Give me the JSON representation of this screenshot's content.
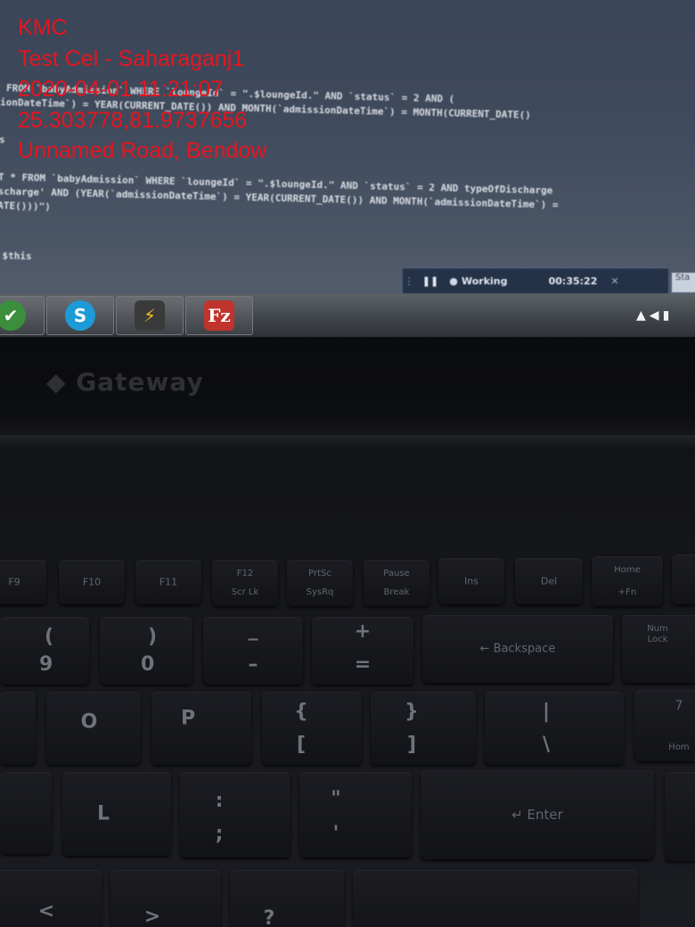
{
  "overlay": {
    "line1": "KMC",
    "line2": "Test Cel - Saharaganj1",
    "line3": "2020-04-01 11:21:07",
    "line4": "25.303778,81.9737656",
    "line5": "Unnamed Road, Bendow",
    "color": "#e8141f"
  },
  "screen": {
    "code_lines": [
      "* FROM `babyAdmission` WHERE `loungeId` = \".$loungeId.\" AND `status` = 2 AND (",
      "sionDateTime`) = YEAR(CURRENT_DATE()) AND MONTH(`admissionDateTime`) = MONTH(CURRENT_DATE()",
      "ls",
      "CT * FROM `babyAdmission` WHERE `loungeId` = \".$loungeId.\" AND `status` = 2 AND typeOfDischarge",
      "ischarge' AND (YEAR(`admissionDateTime`) = YEAR(CURRENT_DATE()) AND MONTH(`admissionDateTime`) =",
      "DATE()))\")",
      ";",
      "= $this"
    ],
    "recorder": {
      "status": "Working",
      "timer": "00:35:22"
    },
    "taskbar_apps": [
      "check-icon",
      "skype-icon",
      "zap-icon",
      "filezilla-icon"
    ],
    "filezilla_label": "Fz",
    "skype_label": "S"
  },
  "laptop": {
    "brand": "Gateway"
  },
  "keyboard": {
    "function_row": [
      {
        "top": "",
        "main": "F9",
        "bottom": ""
      },
      {
        "top": "",
        "main": "F10",
        "bottom": ""
      },
      {
        "top": "",
        "main": "F11",
        "bottom": ""
      },
      {
        "top": "F12",
        "main": "",
        "bottom": "Scr Lk"
      },
      {
        "top": "PrtSc",
        "main": "",
        "bottom": "SysRq"
      },
      {
        "top": "Pause",
        "main": "",
        "bottom": "Break"
      },
      {
        "top": "",
        "main": "Ins",
        "bottom": ""
      },
      {
        "top": "",
        "main": "Del",
        "bottom": ""
      },
      {
        "top": "Home",
        "main": "",
        "bottom": "+Fn"
      }
    ],
    "number_row": [
      {
        "top": "(",
        "bottom": "9"
      },
      {
        "top": ")",
        "bottom": "0"
      },
      {
        "top": "_",
        "bottom": "–"
      },
      {
        "top": "+",
        "bottom": "="
      },
      {
        "main": "← Backspace"
      },
      {
        "top": "Num",
        "bottom": "Lock"
      }
    ],
    "letter_row": [
      {
        "main": "O"
      },
      {
        "main": "P"
      },
      {
        "top": "{",
        "bottom": "["
      },
      {
        "top": "}",
        "bottom": "]"
      },
      {
        "top": "|",
        "bottom": "\\"
      },
      {
        "top": "7",
        "bottom": "Hom"
      }
    ],
    "home_row": [
      {
        "main": "L"
      },
      {
        "top": ":",
        "bottom": ";"
      },
      {
        "top": "\"",
        "bottom": "'"
      },
      {
        "main": "↵ Enter"
      }
    ],
    "bottom_row": [
      {
        "main": "<"
      },
      {
        "main": ">"
      },
      {
        "main": "?"
      }
    ]
  }
}
